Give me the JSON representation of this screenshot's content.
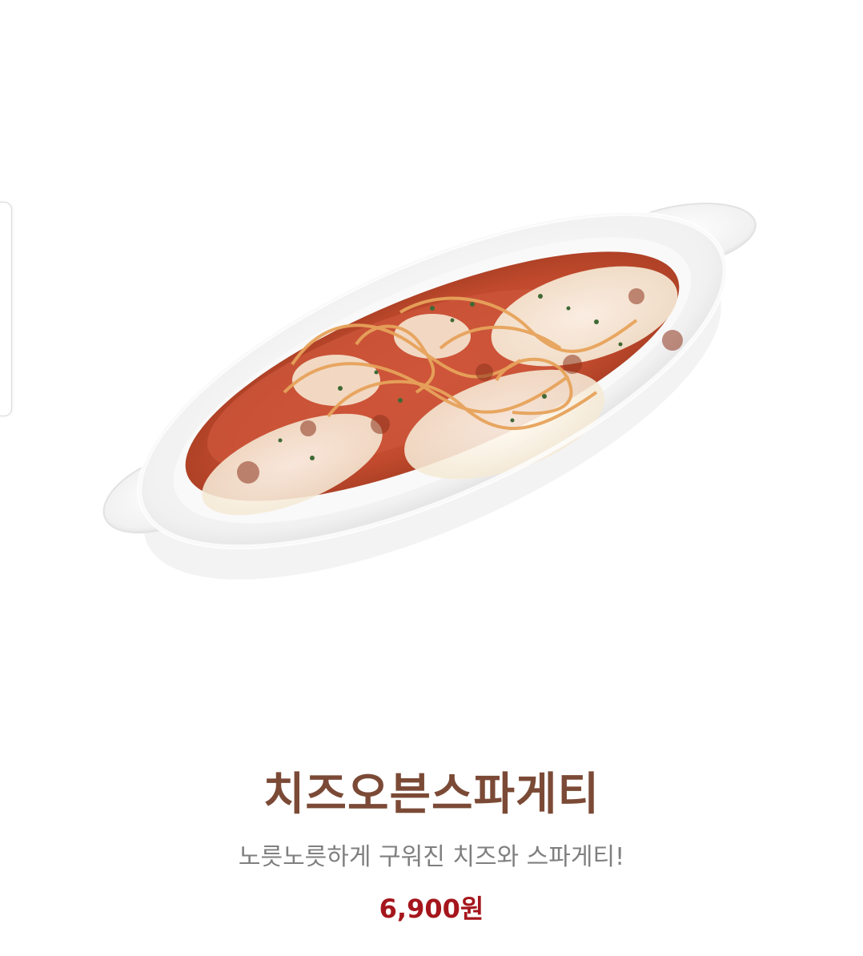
{
  "product": {
    "name": "치즈오븐스파게티",
    "description": "노릇노릇하게 구워진 치즈와 스파게티!",
    "price": "6,900원"
  },
  "colors": {
    "title": "#7b4a36",
    "description": "#7f7f7f",
    "price": "#a5161c"
  },
  "icons": {
    "side_tab": "side-edge-tab"
  }
}
